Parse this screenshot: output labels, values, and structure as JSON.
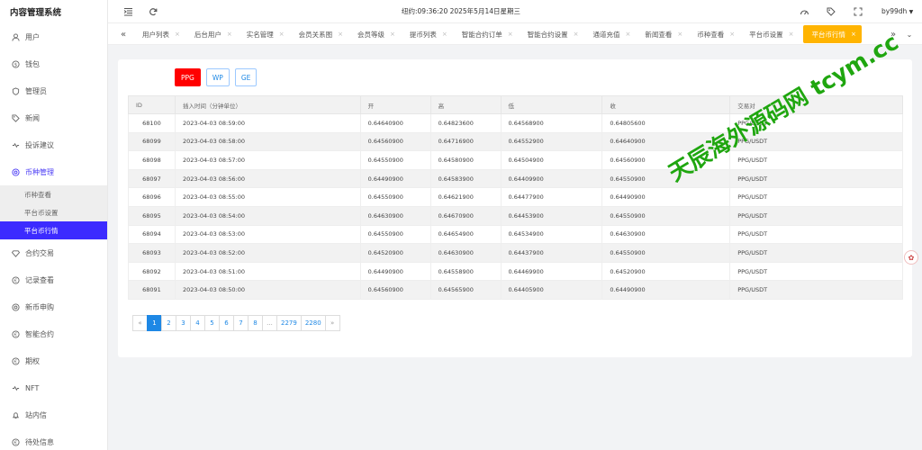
{
  "app": {
    "title": "内容管理系统"
  },
  "header": {
    "datetime": "纽约:09:36:20 2025年5月14日星期三",
    "user": "by99dh"
  },
  "sidebar": {
    "items": [
      {
        "label": "用户",
        "icon": "user-icon"
      },
      {
        "label": "钱包",
        "icon": "wallet-icon"
      },
      {
        "label": "管理员",
        "icon": "shield-icon"
      },
      {
        "label": "新闻",
        "icon": "tag-icon"
      },
      {
        "label": "投诉建议",
        "icon": "feedback-icon"
      },
      {
        "label": "币种管理",
        "icon": "coin-icon"
      }
    ],
    "submenu": [
      {
        "label": "币种查看"
      },
      {
        "label": "平台币设置"
      },
      {
        "label": "平台币行情"
      }
    ],
    "items_after": [
      {
        "label": "合约交易",
        "icon": "diamond-icon"
      },
      {
        "label": "记录查看",
        "icon": "record-icon"
      },
      {
        "label": "新币申购",
        "icon": "new-coin-icon"
      },
      {
        "label": "智能合约",
        "icon": "contract-icon"
      },
      {
        "label": "期权",
        "icon": "option-icon"
      },
      {
        "label": "NFT",
        "icon": "nft-icon"
      },
      {
        "label": "站内信",
        "icon": "bell-icon"
      },
      {
        "label": "待处信息",
        "icon": "info-icon"
      }
    ]
  },
  "tabs": [
    {
      "label": "用户列表"
    },
    {
      "label": "后台用户"
    },
    {
      "label": "实名管理"
    },
    {
      "label": "会员关系图"
    },
    {
      "label": "会员等级"
    },
    {
      "label": "提币列表"
    },
    {
      "label": "智能合约订单"
    },
    {
      "label": "智能合约设置"
    },
    {
      "label": "通道充值"
    },
    {
      "label": "新闻查看"
    },
    {
      "label": "币种查看"
    },
    {
      "label": "平台币设置"
    },
    {
      "label": "平台币行情"
    }
  ],
  "filters": [
    {
      "label": "PPG"
    },
    {
      "label": "WP"
    },
    {
      "label": "GE"
    }
  ],
  "table": {
    "headers": [
      "ID",
      "插入时间（分钟单位）",
      "开",
      "高",
      "低",
      "收",
      "交易对"
    ],
    "rows": [
      [
        "68100",
        "2023-04-03 08:59:00",
        "0.64640900",
        "0.64823600",
        "0.64568900",
        "0.64805600",
        "PPG/USDT"
      ],
      [
        "68099",
        "2023-04-03 08:58:00",
        "0.64560900",
        "0.64716900",
        "0.64552900",
        "0.64640900",
        "PPG/USDT"
      ],
      [
        "68098",
        "2023-04-03 08:57:00",
        "0.64550900",
        "0.64580900",
        "0.64504900",
        "0.64560900",
        "PPG/USDT"
      ],
      [
        "68097",
        "2023-04-03 08:56:00",
        "0.64490900",
        "0.64583900",
        "0.64409900",
        "0.64550900",
        "PPG/USDT"
      ],
      [
        "68096",
        "2023-04-03 08:55:00",
        "0.64550900",
        "0.64621900",
        "0.64477900",
        "0.64490900",
        "PPG/USDT"
      ],
      [
        "68095",
        "2023-04-03 08:54:00",
        "0.64630900",
        "0.64670900",
        "0.64453900",
        "0.64550900",
        "PPG/USDT"
      ],
      [
        "68094",
        "2023-04-03 08:53:00",
        "0.64550900",
        "0.64654900",
        "0.64534900",
        "0.64630900",
        "PPG/USDT"
      ],
      [
        "68093",
        "2023-04-03 08:52:00",
        "0.64520900",
        "0.64630900",
        "0.64437900",
        "0.64550900",
        "PPG/USDT"
      ],
      [
        "68092",
        "2023-04-03 08:51:00",
        "0.64490900",
        "0.64558900",
        "0.64469900",
        "0.64520900",
        "PPG/USDT"
      ],
      [
        "68091",
        "2023-04-03 08:50:00",
        "0.64560900",
        "0.64565900",
        "0.64405900",
        "0.64490900",
        "PPG/USDT"
      ]
    ]
  },
  "pagination": [
    "«",
    "1",
    "2",
    "3",
    "4",
    "5",
    "6",
    "7",
    "8",
    "...",
    "2279",
    "2280",
    "»"
  ],
  "watermark": "天辰海外源码网 tcym.cc"
}
